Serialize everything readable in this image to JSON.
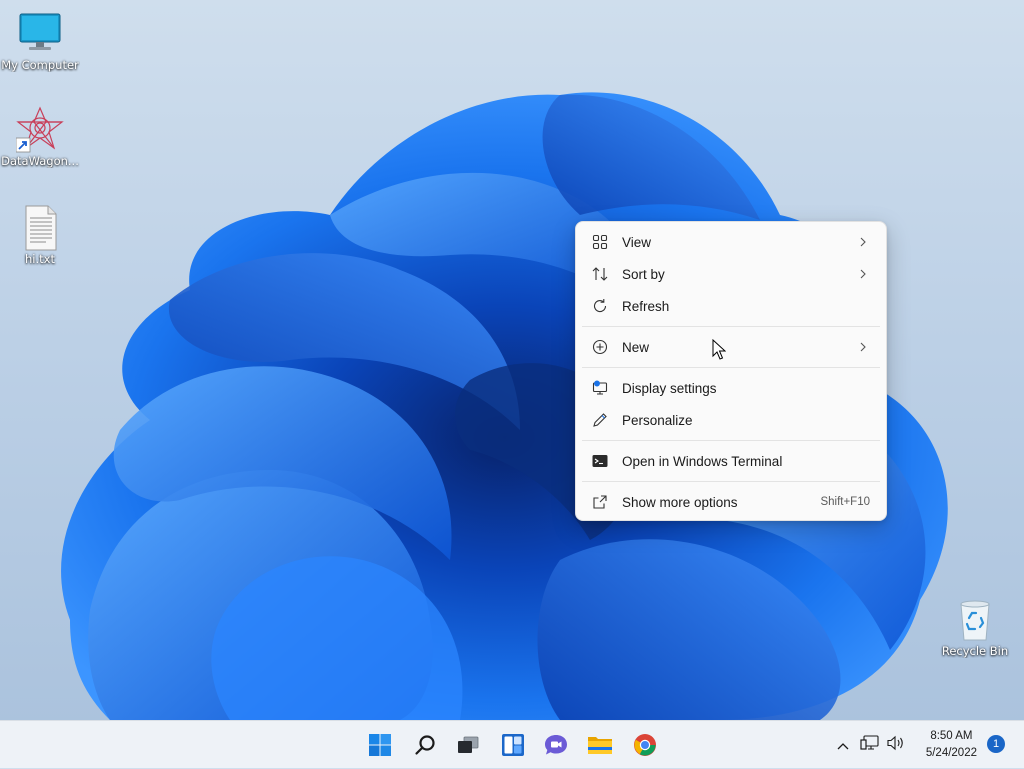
{
  "desktop": {
    "icons": [
      {
        "label": "My Computer",
        "icon": "monitor-icon"
      },
      {
        "label": "DataWagon...",
        "icon": "datawagon-app-icon"
      },
      {
        "label": "hi.txt",
        "icon": "text-file-icon"
      },
      {
        "label": "Recycle Bin",
        "icon": "recycle-bin-icon"
      }
    ]
  },
  "context_menu": {
    "items": [
      {
        "label": "View",
        "icon": "grid-view-icon",
        "submenu": true
      },
      {
        "label": "Sort by",
        "icon": "sort-icon",
        "submenu": true
      },
      {
        "label": "Refresh",
        "icon": "refresh-icon"
      },
      {
        "label": "New",
        "icon": "plus-circle-icon",
        "submenu": true
      },
      {
        "label": "Display settings",
        "icon": "display-settings-icon"
      },
      {
        "label": "Personalize",
        "icon": "pen-icon"
      },
      {
        "label": "Open in Windows Terminal",
        "icon": "terminal-icon"
      },
      {
        "label": "Show more options",
        "icon": "external-open-icon",
        "accelerator": "Shift+F10"
      }
    ]
  },
  "taskbar": {
    "apps": [
      "windows-start-icon",
      "search-icon",
      "task-view-icon",
      "widgets-icon",
      "chat-icon",
      "file-explorer-icon",
      "chrome-icon"
    ],
    "tray": [
      "chevron-up-icon",
      "network-icon",
      "volume-icon"
    ],
    "clock": {
      "time": "8:50 AM",
      "date": "5/24/2022"
    },
    "notification_count": "1"
  },
  "colors": {
    "accent": "#0067c0",
    "wallpaper_bg": "#bcd0e6",
    "bloom_blue": "#1166e0",
    "menu_bg": "#fafafa"
  }
}
